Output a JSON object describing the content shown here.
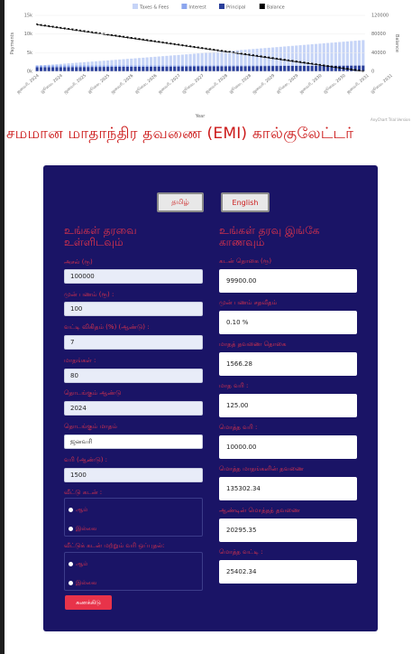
{
  "chart_data": {
    "type": "bar",
    "legend": [
      {
        "name": "Taxes & Fees",
        "color": "#c6d4f7"
      },
      {
        "name": "Interest",
        "color": "#8ca6ee"
      },
      {
        "name": "Principal",
        "color": "#2a3f9a"
      },
      {
        "name": "Balance",
        "color": "#000000"
      }
    ],
    "ylabel_left": "Payments",
    "ylabel_right": "Balance",
    "xlabel": "Year",
    "yticks_left": [
      "15k",
      "10k",
      "5k",
      "0k"
    ],
    "yticks_right": [
      "120000",
      "80000",
      "40000",
      "0"
    ],
    "ylim_left": [
      0,
      15000
    ],
    "ylim_right": [
      0,
      120000
    ],
    "xticks": [
      "ஜனவரி, 2024",
      "ஜூலை, 2024",
      "ஜனவரி, 2025",
      "ஜூலை, 2025",
      "ஜனவரி, 2026",
      "ஜூலை, 2026",
      "ஜனவரி, 2027",
      "ஜூலை, 2027",
      "ஜனவரி, 2028",
      "ஜூலை, 2028",
      "ஜனவரி, 2029",
      "ஜூலை, 2029",
      "ஜனவரி, 2030",
      "ஜூலை, 2030",
      "ஜனவரி, 2031",
      "ஜூலை, 2031"
    ],
    "months": 84,
    "series": [
      {
        "name": "Principal",
        "start": 1100,
        "end": 1560
      },
      {
        "name": "Interest",
        "start": 466,
        "end": 10
      },
      {
        "name": "Taxes & Fees",
        "start": 0,
        "end": 6800
      },
      {
        "name": "Balance",
        "start": 99900,
        "end": 0
      }
    ],
    "credit": "AnyChart Trial Version"
  },
  "title": "சமமான மாதாந்திர தவணை (EMI) கால்குலேட்டர்",
  "lang": {
    "tamil": "தமிழ்",
    "english": "English"
  },
  "left": {
    "heading": "உங்கள் தரவை உள்ளிடவும்",
    "fields": [
      {
        "label": "அசல் (ரூ)",
        "value": "100000"
      },
      {
        "label": "முன் பணம் (ரூ) :",
        "value": "100"
      },
      {
        "label": "வட்டி விகிதம் (%) (ஆண்டு) :",
        "value": "7"
      },
      {
        "label": "மாதங்கள் :",
        "value": "80"
      },
      {
        "label": "தொடங்கும் ஆண்டு",
        "value": "2024"
      },
      {
        "label": "தொடங்கும் மாதம்",
        "value": "ஜனவரி"
      },
      {
        "label": "வரி (ஆண்டு) :",
        "value": "1500"
      }
    ],
    "radio1": {
      "label": "வீட்டு கடன் :",
      "yes": "ஆம்",
      "no": "இல்லை"
    },
    "radio2": {
      "label": "வீட்டுக் கடன் மற்றும் வரி ஒப்புதல்:",
      "yes": "ஆம்",
      "no": "இல்லை"
    },
    "submit": "கணக்கிடு"
  },
  "right": {
    "heading": "உங்கள் தரவு இங்கே காணவும்",
    "fields": [
      {
        "label": "கடன் தொகை (ரூ)",
        "value": "99900.00"
      },
      {
        "label": "முன் பணம் சதவீதம்",
        "value": "0.10 %"
      },
      {
        "label": "மாதத் தவணை தொகை",
        "value": "1566.28"
      },
      {
        "label": "மாத வரி :",
        "value": "125.00"
      },
      {
        "label": "மொத்த வரி :",
        "value": "10000.00"
      },
      {
        "label": "மொத்த மாதங்களின் தவணை",
        "value": "135302.34"
      },
      {
        "label": "ஆண்டின் மொத்தத் தவணை",
        "value": "20295.35"
      },
      {
        "label": "மொத்த வட்டி :",
        "value": "25402.34"
      }
    ]
  }
}
